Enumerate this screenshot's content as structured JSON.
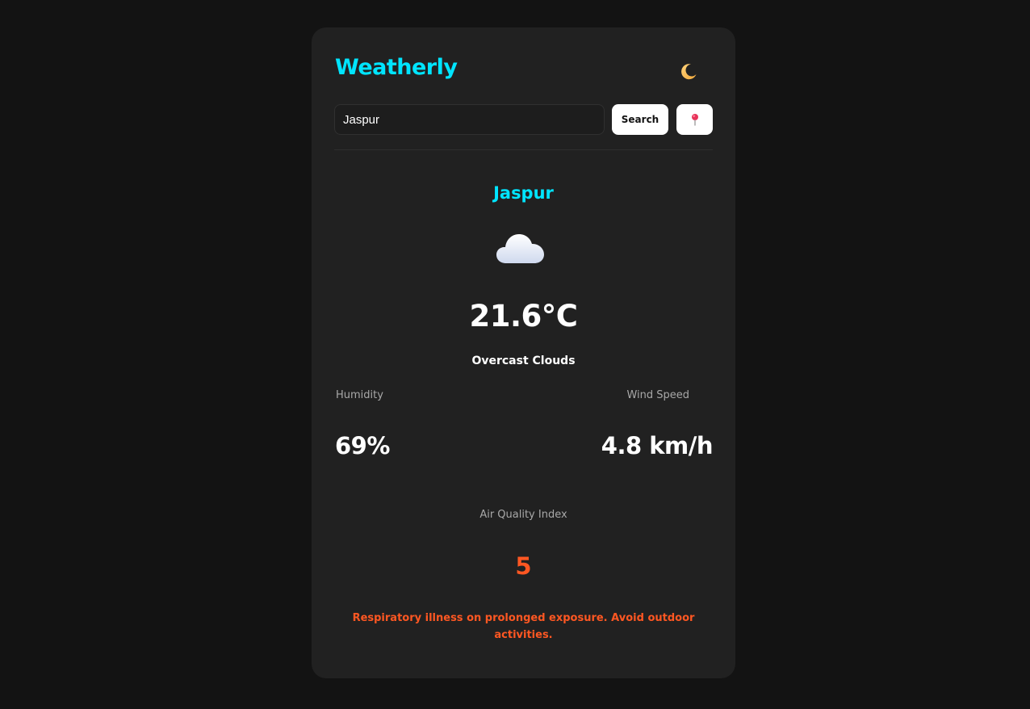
{
  "app": {
    "brand": "Weatherly",
    "theme_icon": "moon-icon"
  },
  "search": {
    "value": "Jaspur",
    "placeholder": "",
    "button_label": "Search",
    "location_icon": "pin-icon"
  },
  "weather": {
    "city": "Jaspur",
    "icon": "cloud-icon",
    "temperature": "21.6°C",
    "condition": "Overcast Clouds",
    "humidity_label": "Humidity",
    "humidity_value": "69%",
    "wind_label": "Wind Speed",
    "wind_value": "4.8 km/h",
    "aqi_label": "Air Quality Index",
    "aqi_value": "5",
    "aqi_message": "Respiratory illness on prolonged exposure. Avoid outdoor activities."
  },
  "colors": {
    "page_bg": "#131313",
    "card_bg": "#212121",
    "accent": "#00e5ff",
    "aqi_warning": "#ff5722",
    "text": "#ffffff",
    "muted": "#a8a8a8"
  }
}
